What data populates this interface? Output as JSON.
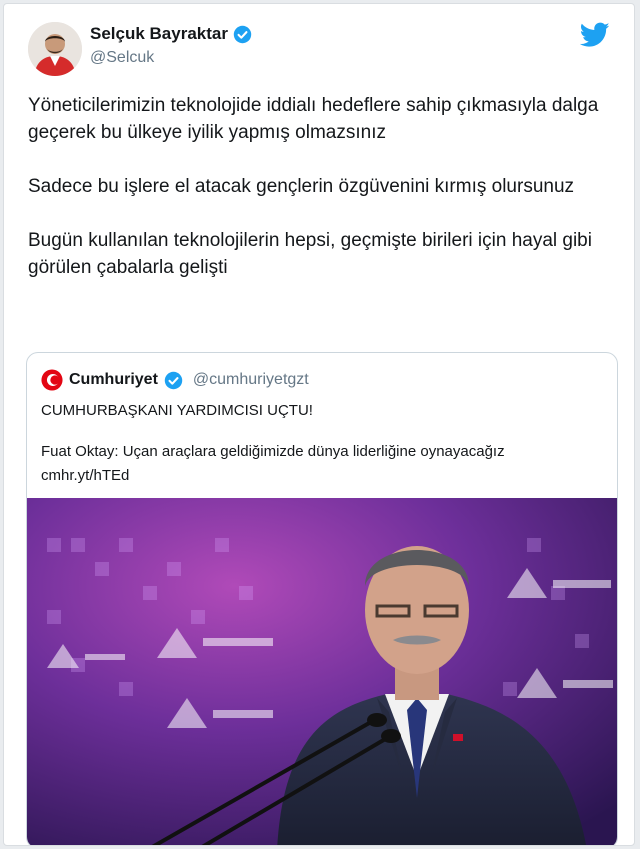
{
  "tweet": {
    "author_name": "Selçuk Bayraktar",
    "handle": "@Selcuk",
    "paragraphs": [
      "Yöneticilerimizin teknolojide iddialı hedeflere sahip çıkmasıyla dalga geçerek bu ülkeye iyilik yapmış olmazsınız",
      "Sadece bu işlere el atacak gençlerin özgüvenini kırmış olursunuz",
      "Bugün kullanılan teknolojilerin hepsi, geçmişte birileri için hayal gibi görülen çabalarla gelişti"
    ]
  },
  "quoted": {
    "name": "Cumhuriyet",
    "handle": "@cumhuriyetgzt",
    "headline": "CUMHURBAŞKANI YARDIMCISI UÇTU!",
    "body": "Fuat Oktay: Uçan araçlara geldiğimizde dünya liderliğine oynayacağız",
    "link": "cmhr.yt/hTEd"
  },
  "colors": {
    "twitter_blue": "#1da1f2",
    "brand_red": "#e30613",
    "image_purple": "#5b2a86"
  },
  "icons": [
    "verified-icon",
    "twitter-bird-icon",
    "cumhuriyet-logo-icon"
  ]
}
